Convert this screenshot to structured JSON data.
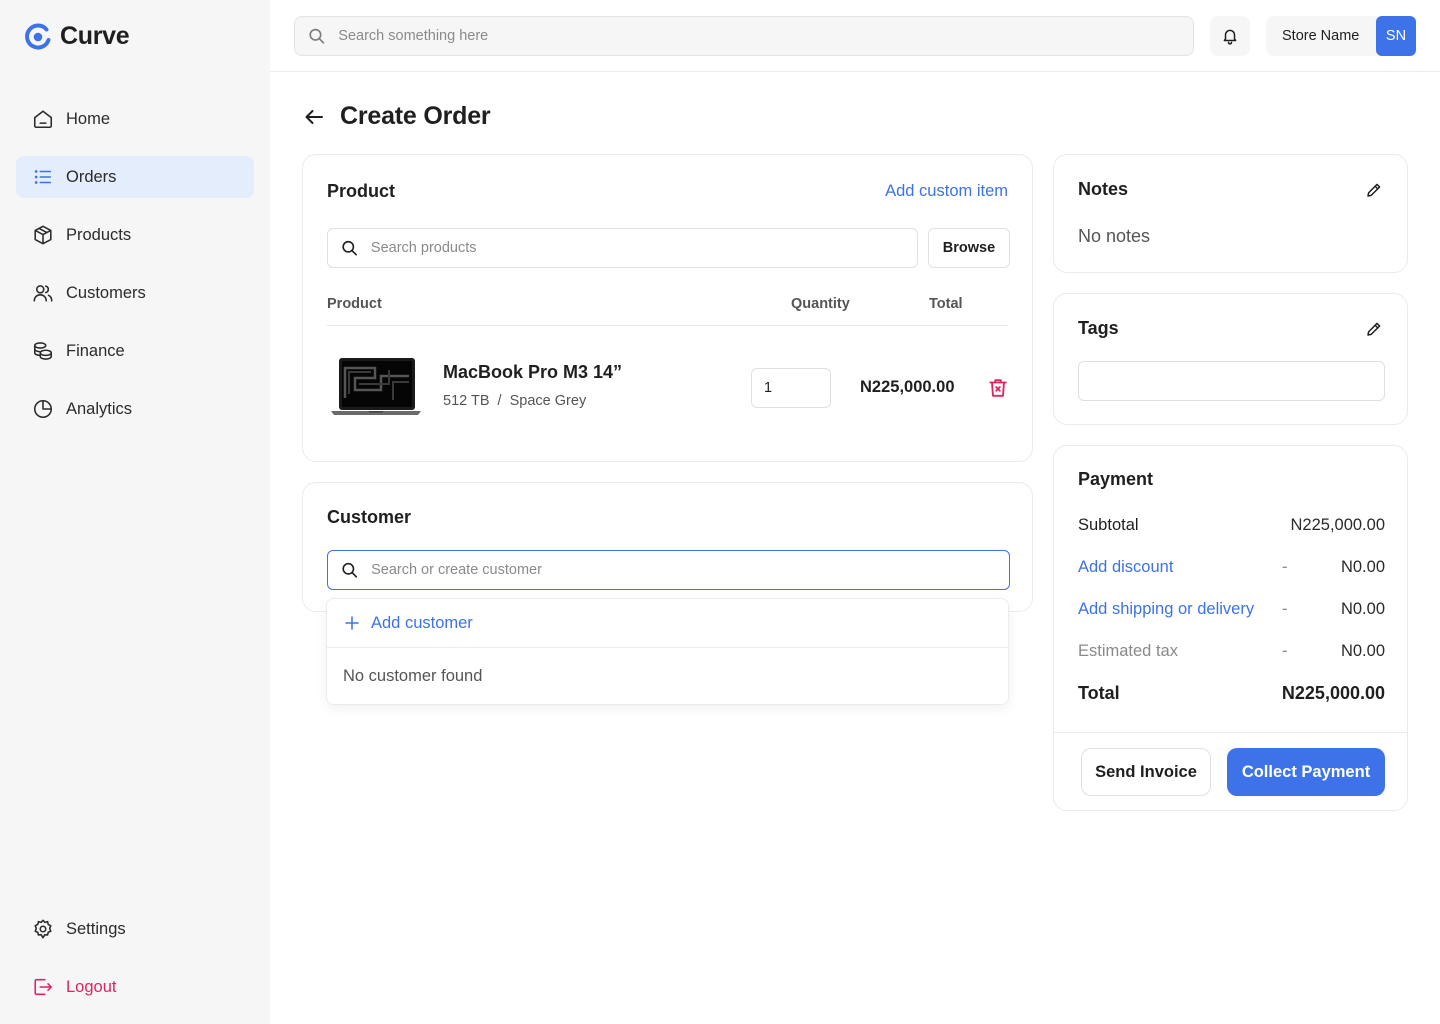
{
  "app": {
    "name": "Curve"
  },
  "colors": {
    "accent": "#3d72e8",
    "danger": "#e0245e",
    "sidebar_bg": "#f6f6f7",
    "active_nav_bg": "#e3edfb"
  },
  "sidebar": {
    "items": [
      {
        "label": "Home",
        "icon": "home-icon"
      },
      {
        "label": "Orders",
        "icon": "list-icon",
        "active": true
      },
      {
        "label": "Products",
        "icon": "box-icon"
      },
      {
        "label": "Customers",
        "icon": "users-icon"
      },
      {
        "label": "Finance",
        "icon": "coins-icon"
      },
      {
        "label": "Analytics",
        "icon": "pie-chart-icon"
      }
    ],
    "bottom": [
      {
        "label": "Settings",
        "icon": "gear-icon"
      },
      {
        "label": "Logout",
        "icon": "logout-icon"
      }
    ]
  },
  "topbar": {
    "search_placeholder": "Search something here",
    "store_name": "Store Name",
    "avatar_initials": "SN"
  },
  "page": {
    "title": "Create Order"
  },
  "product_section": {
    "title": "Product",
    "add_custom_label": "Add custom item",
    "search_placeholder": "Search products",
    "browse_label": "Browse",
    "columns": {
      "product": "Product",
      "quantity": "Quantity",
      "total": "Total"
    },
    "items": [
      {
        "name": "MacBook Pro M3 14”",
        "variant": "512 TB  /  Space Grey",
        "quantity": "1",
        "total": "N225,000.00"
      }
    ]
  },
  "customer_section": {
    "title": "Customer",
    "search_placeholder": "Search or create customer",
    "dropdown": {
      "add_label": "Add customer",
      "empty_label": "No customer found"
    }
  },
  "notes": {
    "title": "Notes",
    "value": "No notes"
  },
  "tags": {
    "title": "Tags"
  },
  "payment": {
    "title": "Payment",
    "subtotal": {
      "label": "Subtotal",
      "value": "N225,000.00"
    },
    "discount": {
      "label": "Add discount",
      "dash": "-",
      "value": "N0.00"
    },
    "shipping": {
      "label": "Add shipping or delivery",
      "dash": "-",
      "value": "N0.00"
    },
    "tax": {
      "label": "Estimated tax",
      "dash": "-",
      "value": "N0.00"
    },
    "total": {
      "label": "Total",
      "value": "N225,000.00"
    },
    "send_invoice_label": "Send Invoice",
    "collect_payment_label": "Collect Payment"
  }
}
